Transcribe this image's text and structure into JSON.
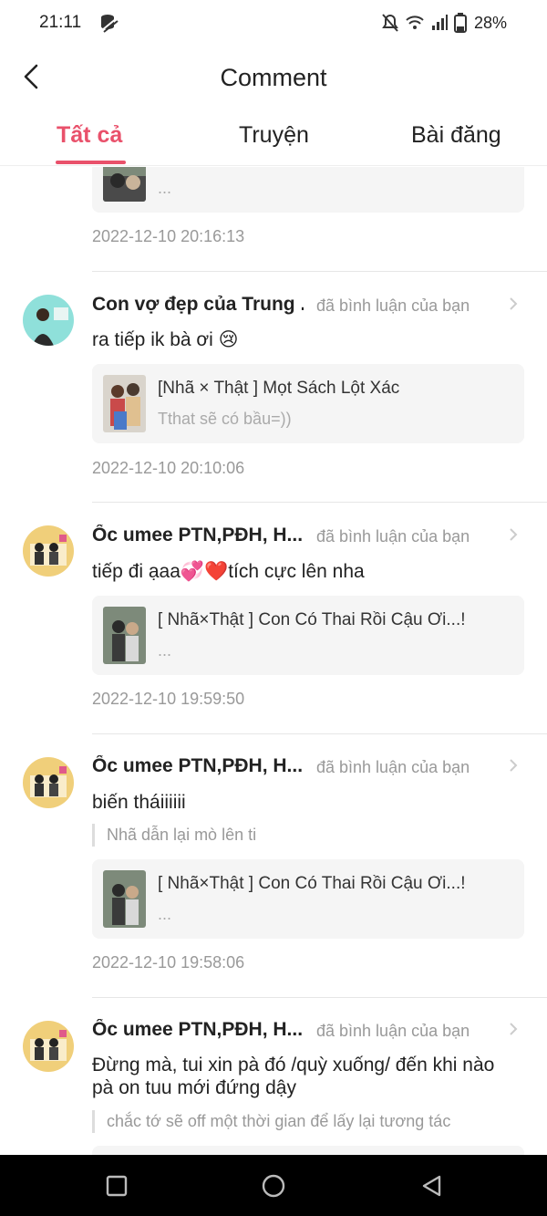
{
  "status": {
    "time": "21:11",
    "battery": "28%"
  },
  "header": {
    "title": "Comment"
  },
  "tabs": [
    {
      "label": "Tất cả",
      "active": true
    },
    {
      "label": "Truyện",
      "active": false
    },
    {
      "label": "Bài đăng",
      "active": false
    }
  ],
  "items": [
    {
      "card": {
        "title": "",
        "sub": "..."
      },
      "date": "2022-12-10 20:16:13"
    },
    {
      "name": "Con vợ đẹp của Trung ...",
      "action": "đã bình luận của bạn",
      "text": "ra tiếp ik bà ơi 😢",
      "card": {
        "title": "[Nhã × Thật ] Mọt Sách Lột Xác",
        "sub": "Tthat sẽ có bầu=))"
      },
      "date": "2022-12-10 20:10:06"
    },
    {
      "name": "Ốc umee PTN,PĐH, H...",
      "action": "đã bình luận của bạn",
      "text": "tiếp đi ạaa💞❤️tích cực lên nha",
      "card": {
        "title": "[ Nhã×Thật ] Con Có Thai Rồi Cậu Ơi...!",
        "sub": "..."
      },
      "date": "2022-12-10 19:59:50"
    },
    {
      "name": "Ốc umee PTN,PĐH, H...",
      "action": "đã bình luận của bạn",
      "text": "biến tháiiiiii",
      "quote": "Nhã dẫn lại mò lên ti",
      "card": {
        "title": "[ Nhã×Thật ] Con Có Thai Rồi Cậu Ơi...!",
        "sub": "..."
      },
      "date": "2022-12-10 19:58:06"
    },
    {
      "name": "Ốc umee PTN,PĐH, H...",
      "action": "đã bình luận của bạn",
      "text": "Đừng mà, tui xin pà đó /quỳ xuống/ đến khi nào pà on tuu mới đứng dậy",
      "quote": "chắc tớ sẽ off một thời gian để lấy lại tương tác"
    }
  ]
}
